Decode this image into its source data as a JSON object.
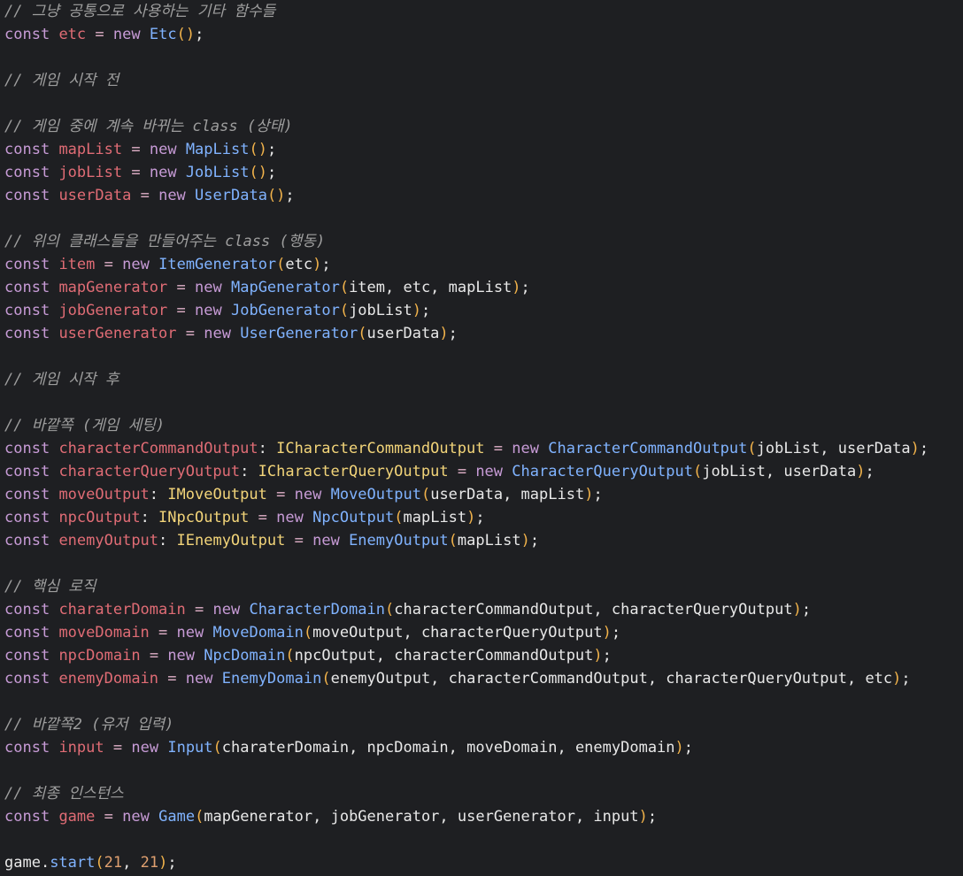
{
  "editor": {
    "background": "#1e1f22",
    "lines": [
      [
        {
          "c": "cm",
          "t": "// 그냥 공통으로 사용하는 기타 함수들"
        }
      ],
      [
        {
          "c": "kw",
          "t": "const"
        },
        {
          "c": "tx",
          "t": " "
        },
        {
          "c": "vr",
          "t": "etc"
        },
        {
          "c": "tx",
          "t": " "
        },
        {
          "c": "op",
          "t": "="
        },
        {
          "c": "tx",
          "t": " "
        },
        {
          "c": "kw",
          "t": "new"
        },
        {
          "c": "tx",
          "t": " "
        },
        {
          "c": "cl",
          "t": "Etc"
        },
        {
          "c": "pn",
          "t": "()"
        },
        {
          "c": "tx",
          "t": ";"
        }
      ],
      [],
      [
        {
          "c": "cm",
          "t": "// 게임 시작 전"
        }
      ],
      [],
      [
        {
          "c": "cm",
          "t": "// 게임 중에 계속 바뀌는 class (상태)"
        }
      ],
      [
        {
          "c": "kw",
          "t": "const"
        },
        {
          "c": "tx",
          "t": " "
        },
        {
          "c": "vr",
          "t": "mapList"
        },
        {
          "c": "tx",
          "t": " "
        },
        {
          "c": "op",
          "t": "="
        },
        {
          "c": "tx",
          "t": " "
        },
        {
          "c": "kw",
          "t": "new"
        },
        {
          "c": "tx",
          "t": " "
        },
        {
          "c": "cl",
          "t": "MapList"
        },
        {
          "c": "pn",
          "t": "()"
        },
        {
          "c": "tx",
          "t": ";"
        }
      ],
      [
        {
          "c": "kw",
          "t": "const"
        },
        {
          "c": "tx",
          "t": " "
        },
        {
          "c": "vr",
          "t": "jobList"
        },
        {
          "c": "tx",
          "t": " "
        },
        {
          "c": "op",
          "t": "="
        },
        {
          "c": "tx",
          "t": " "
        },
        {
          "c": "kw",
          "t": "new"
        },
        {
          "c": "tx",
          "t": " "
        },
        {
          "c": "cl",
          "t": "JobList"
        },
        {
          "c": "pn",
          "t": "()"
        },
        {
          "c": "tx",
          "t": ";"
        }
      ],
      [
        {
          "c": "kw",
          "t": "const"
        },
        {
          "c": "tx",
          "t": " "
        },
        {
          "c": "vr",
          "t": "userData"
        },
        {
          "c": "tx",
          "t": " "
        },
        {
          "c": "op",
          "t": "="
        },
        {
          "c": "tx",
          "t": " "
        },
        {
          "c": "kw",
          "t": "new"
        },
        {
          "c": "tx",
          "t": " "
        },
        {
          "c": "cl",
          "t": "UserData"
        },
        {
          "c": "pn",
          "t": "()"
        },
        {
          "c": "tx",
          "t": ";"
        }
      ],
      [],
      [
        {
          "c": "cm",
          "t": "// 위의 클래스들을 만들어주는 class (행동)"
        }
      ],
      [
        {
          "c": "kw",
          "t": "const"
        },
        {
          "c": "tx",
          "t": " "
        },
        {
          "c": "vr",
          "t": "item"
        },
        {
          "c": "tx",
          "t": " "
        },
        {
          "c": "op",
          "t": "="
        },
        {
          "c": "tx",
          "t": " "
        },
        {
          "c": "kw",
          "t": "new"
        },
        {
          "c": "tx",
          "t": " "
        },
        {
          "c": "cl",
          "t": "ItemGenerator"
        },
        {
          "c": "pn",
          "t": "("
        },
        {
          "c": "tx",
          "t": "etc"
        },
        {
          "c": "pn",
          "t": ")"
        },
        {
          "c": "tx",
          "t": ";"
        }
      ],
      [
        {
          "c": "kw",
          "t": "const"
        },
        {
          "c": "tx",
          "t": " "
        },
        {
          "c": "vr",
          "t": "mapGenerator"
        },
        {
          "c": "tx",
          "t": " "
        },
        {
          "c": "op",
          "t": "="
        },
        {
          "c": "tx",
          "t": " "
        },
        {
          "c": "kw",
          "t": "new"
        },
        {
          "c": "tx",
          "t": " "
        },
        {
          "c": "cl",
          "t": "MapGenerator"
        },
        {
          "c": "pn",
          "t": "("
        },
        {
          "c": "tx",
          "t": "item, etc, mapList"
        },
        {
          "c": "pn",
          "t": ")"
        },
        {
          "c": "tx",
          "t": ";"
        }
      ],
      [
        {
          "c": "kw",
          "t": "const"
        },
        {
          "c": "tx",
          "t": " "
        },
        {
          "c": "vr",
          "t": "jobGenerator"
        },
        {
          "c": "tx",
          "t": " "
        },
        {
          "c": "op",
          "t": "="
        },
        {
          "c": "tx",
          "t": " "
        },
        {
          "c": "kw",
          "t": "new"
        },
        {
          "c": "tx",
          "t": " "
        },
        {
          "c": "cl",
          "t": "JobGenerator"
        },
        {
          "c": "pn",
          "t": "("
        },
        {
          "c": "tx",
          "t": "jobList"
        },
        {
          "c": "pn",
          "t": ")"
        },
        {
          "c": "tx",
          "t": ";"
        }
      ],
      [
        {
          "c": "kw",
          "t": "const"
        },
        {
          "c": "tx",
          "t": " "
        },
        {
          "c": "vr",
          "t": "userGenerator"
        },
        {
          "c": "tx",
          "t": " "
        },
        {
          "c": "op",
          "t": "="
        },
        {
          "c": "tx",
          "t": " "
        },
        {
          "c": "kw",
          "t": "new"
        },
        {
          "c": "tx",
          "t": " "
        },
        {
          "c": "cl",
          "t": "UserGenerator"
        },
        {
          "c": "pn",
          "t": "("
        },
        {
          "c": "tx",
          "t": "userData"
        },
        {
          "c": "pn",
          "t": ")"
        },
        {
          "c": "tx",
          "t": ";"
        }
      ],
      [],
      [
        {
          "c": "cm",
          "t": "// 게임 시작 후"
        }
      ],
      [],
      [
        {
          "c": "cm",
          "t": "// 바깥쪽 (게임 세팅)"
        }
      ],
      [
        {
          "c": "kw",
          "t": "const"
        },
        {
          "c": "tx",
          "t": " "
        },
        {
          "c": "vr",
          "t": "characterCommandOutput"
        },
        {
          "c": "tx",
          "t": ": "
        },
        {
          "c": "tp",
          "t": "ICharacterCommandOutput"
        },
        {
          "c": "tx",
          "t": " "
        },
        {
          "c": "op",
          "t": "="
        },
        {
          "c": "tx",
          "t": " "
        },
        {
          "c": "kw",
          "t": "new"
        },
        {
          "c": "tx",
          "t": " "
        },
        {
          "c": "cl",
          "t": "CharacterCommandOutput"
        },
        {
          "c": "pn",
          "t": "("
        },
        {
          "c": "tx",
          "t": "jobList, userData"
        },
        {
          "c": "pn",
          "t": ")"
        },
        {
          "c": "tx",
          "t": ";"
        }
      ],
      [
        {
          "c": "kw",
          "t": "const"
        },
        {
          "c": "tx",
          "t": " "
        },
        {
          "c": "vr",
          "t": "characterQueryOutput"
        },
        {
          "c": "tx",
          "t": ": "
        },
        {
          "c": "tp",
          "t": "ICharacterQueryOutput"
        },
        {
          "c": "tx",
          "t": " "
        },
        {
          "c": "op",
          "t": "="
        },
        {
          "c": "tx",
          "t": " "
        },
        {
          "c": "kw",
          "t": "new"
        },
        {
          "c": "tx",
          "t": " "
        },
        {
          "c": "cl",
          "t": "CharacterQueryOutput"
        },
        {
          "c": "pn",
          "t": "("
        },
        {
          "c": "tx",
          "t": "jobList, userData"
        },
        {
          "c": "pn",
          "t": ")"
        },
        {
          "c": "tx",
          "t": ";"
        }
      ],
      [
        {
          "c": "kw",
          "t": "const"
        },
        {
          "c": "tx",
          "t": " "
        },
        {
          "c": "vr",
          "t": "moveOutput"
        },
        {
          "c": "tx",
          "t": ": "
        },
        {
          "c": "tp",
          "t": "IMoveOutput"
        },
        {
          "c": "tx",
          "t": " "
        },
        {
          "c": "op",
          "t": "="
        },
        {
          "c": "tx",
          "t": " "
        },
        {
          "c": "kw",
          "t": "new"
        },
        {
          "c": "tx",
          "t": " "
        },
        {
          "c": "cl",
          "t": "MoveOutput"
        },
        {
          "c": "pn",
          "t": "("
        },
        {
          "c": "tx",
          "t": "userData, mapList"
        },
        {
          "c": "pn",
          "t": ")"
        },
        {
          "c": "tx",
          "t": ";"
        }
      ],
      [
        {
          "c": "kw",
          "t": "const"
        },
        {
          "c": "tx",
          "t": " "
        },
        {
          "c": "vr",
          "t": "npcOutput"
        },
        {
          "c": "tx",
          "t": ": "
        },
        {
          "c": "tp",
          "t": "INpcOutput"
        },
        {
          "c": "tx",
          "t": " "
        },
        {
          "c": "op",
          "t": "="
        },
        {
          "c": "tx",
          "t": " "
        },
        {
          "c": "kw",
          "t": "new"
        },
        {
          "c": "tx",
          "t": " "
        },
        {
          "c": "cl",
          "t": "NpcOutput"
        },
        {
          "c": "pn",
          "t": "("
        },
        {
          "c": "tx",
          "t": "mapList"
        },
        {
          "c": "pn",
          "t": ")"
        },
        {
          "c": "tx",
          "t": ";"
        }
      ],
      [
        {
          "c": "kw",
          "t": "const"
        },
        {
          "c": "tx",
          "t": " "
        },
        {
          "c": "vr",
          "t": "enemyOutput"
        },
        {
          "c": "tx",
          "t": ": "
        },
        {
          "c": "tp",
          "t": "IEnemyOutput"
        },
        {
          "c": "tx",
          "t": " "
        },
        {
          "c": "op",
          "t": "="
        },
        {
          "c": "tx",
          "t": " "
        },
        {
          "c": "kw",
          "t": "new"
        },
        {
          "c": "tx",
          "t": " "
        },
        {
          "c": "cl",
          "t": "EnemyOutput"
        },
        {
          "c": "pn",
          "t": "("
        },
        {
          "c": "tx",
          "t": "mapList"
        },
        {
          "c": "pn",
          "t": ")"
        },
        {
          "c": "tx",
          "t": ";"
        }
      ],
      [],
      [
        {
          "c": "cm",
          "t": "// 핵심 로직"
        }
      ],
      [
        {
          "c": "kw",
          "t": "const"
        },
        {
          "c": "tx",
          "t": " "
        },
        {
          "c": "vr",
          "t": "charaterDomain"
        },
        {
          "c": "tx",
          "t": " "
        },
        {
          "c": "op",
          "t": "="
        },
        {
          "c": "tx",
          "t": " "
        },
        {
          "c": "kw",
          "t": "new"
        },
        {
          "c": "tx",
          "t": " "
        },
        {
          "c": "cl",
          "t": "CharacterDomain"
        },
        {
          "c": "pn",
          "t": "("
        },
        {
          "c": "tx",
          "t": "characterCommandOutput, characterQueryOutput"
        },
        {
          "c": "pn",
          "t": ")"
        },
        {
          "c": "tx",
          "t": ";"
        }
      ],
      [
        {
          "c": "kw",
          "t": "const"
        },
        {
          "c": "tx",
          "t": " "
        },
        {
          "c": "vr",
          "t": "moveDomain"
        },
        {
          "c": "tx",
          "t": " "
        },
        {
          "c": "op",
          "t": "="
        },
        {
          "c": "tx",
          "t": " "
        },
        {
          "c": "kw",
          "t": "new"
        },
        {
          "c": "tx",
          "t": " "
        },
        {
          "c": "cl",
          "t": "MoveDomain"
        },
        {
          "c": "pn",
          "t": "("
        },
        {
          "c": "tx",
          "t": "moveOutput, characterQueryOutput"
        },
        {
          "c": "pn",
          "t": ")"
        },
        {
          "c": "tx",
          "t": ";"
        }
      ],
      [
        {
          "c": "kw",
          "t": "const"
        },
        {
          "c": "tx",
          "t": " "
        },
        {
          "c": "vr",
          "t": "npcDomain"
        },
        {
          "c": "tx",
          "t": " "
        },
        {
          "c": "op",
          "t": "="
        },
        {
          "c": "tx",
          "t": " "
        },
        {
          "c": "kw",
          "t": "new"
        },
        {
          "c": "tx",
          "t": " "
        },
        {
          "c": "cl",
          "t": "NpcDomain"
        },
        {
          "c": "pn",
          "t": "("
        },
        {
          "c": "tx",
          "t": "npcOutput, characterCommandOutput"
        },
        {
          "c": "pn",
          "t": ")"
        },
        {
          "c": "tx",
          "t": ";"
        }
      ],
      [
        {
          "c": "kw",
          "t": "const"
        },
        {
          "c": "tx",
          "t": " "
        },
        {
          "c": "vr",
          "t": "enemyDomain"
        },
        {
          "c": "tx",
          "t": " "
        },
        {
          "c": "op",
          "t": "="
        },
        {
          "c": "tx",
          "t": " "
        },
        {
          "c": "kw",
          "t": "new"
        },
        {
          "c": "tx",
          "t": " "
        },
        {
          "c": "cl",
          "t": "EnemyDomain"
        },
        {
          "c": "pn",
          "t": "("
        },
        {
          "c": "tx",
          "t": "enemyOutput, characterCommandOutput, characterQueryOutput, etc"
        },
        {
          "c": "pn",
          "t": ")"
        },
        {
          "c": "tx",
          "t": ";"
        }
      ],
      [],
      [
        {
          "c": "cm",
          "t": "// 바깥쪽2 (유저 입력)"
        }
      ],
      [
        {
          "c": "kw",
          "t": "const"
        },
        {
          "c": "tx",
          "t": " "
        },
        {
          "c": "vr",
          "t": "input"
        },
        {
          "c": "tx",
          "t": " "
        },
        {
          "c": "op",
          "t": "="
        },
        {
          "c": "tx",
          "t": " "
        },
        {
          "c": "kw",
          "t": "new"
        },
        {
          "c": "tx",
          "t": " "
        },
        {
          "c": "cl",
          "t": "Input"
        },
        {
          "c": "pn",
          "t": "("
        },
        {
          "c": "tx",
          "t": "charaterDomain, npcDomain, moveDomain, enemyDomain"
        },
        {
          "c": "pn",
          "t": ")"
        },
        {
          "c": "tx",
          "t": ";"
        }
      ],
      [],
      [
        {
          "c": "cm",
          "t": "// 최종 인스턴스"
        }
      ],
      [
        {
          "c": "kw",
          "t": "const"
        },
        {
          "c": "tx",
          "t": " "
        },
        {
          "c": "vr",
          "t": "game"
        },
        {
          "c": "tx",
          "t": " "
        },
        {
          "c": "op",
          "t": "="
        },
        {
          "c": "tx",
          "t": " "
        },
        {
          "c": "kw",
          "t": "new"
        },
        {
          "c": "tx",
          "t": " "
        },
        {
          "c": "cl",
          "t": "Game"
        },
        {
          "c": "pn",
          "t": "("
        },
        {
          "c": "tx",
          "t": "mapGenerator, jobGenerator, userGenerator, input"
        },
        {
          "c": "pn",
          "t": ")"
        },
        {
          "c": "tx",
          "t": ";"
        }
      ],
      [],
      [
        {
          "c": "tx",
          "t": "game."
        },
        {
          "c": "cl",
          "t": "start"
        },
        {
          "c": "pn",
          "t": "("
        },
        {
          "c": "nm",
          "t": "21"
        },
        {
          "c": "tx",
          "t": ", "
        },
        {
          "c": "nm",
          "t": "21"
        },
        {
          "c": "pn",
          "t": ")"
        },
        {
          "c": "tx",
          "t": ";"
        }
      ]
    ]
  }
}
